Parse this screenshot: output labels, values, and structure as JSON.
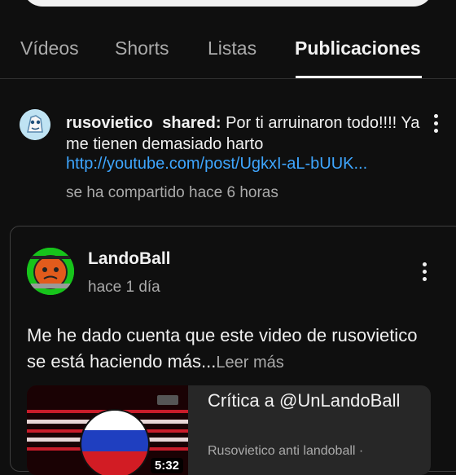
{
  "tabs": [
    {
      "label": "Vídeos"
    },
    {
      "label": "Shorts"
    },
    {
      "label": "Listas"
    },
    {
      "label": "Publicaciones"
    }
  ],
  "active_tab": "Publicaciones",
  "shared_post": {
    "author": "rusovietico",
    "action": "shared:",
    "text": "Por ti arruinaron todo!!!! Ya me tienen demasiado harto",
    "link": "http://youtube.com/post/UgkxI-aL-bUUK...",
    "meta": "se ha compartido hace 6 horas"
  },
  "original_post": {
    "author": "LandoBall",
    "time": "hace 1 día",
    "text": "Me he dado cuenta que este video de rusovietico se está haciendo más...",
    "read_more": "Leer más",
    "video": {
      "title": "Crítica a @UnLandoBall",
      "channel": "Rusovietico anti landoball ·",
      "duration": "5:32"
    }
  },
  "colors": {
    "background": "#0f0f0f",
    "link": "#3ea6ff",
    "secondary_text": "#aaaaaa"
  }
}
